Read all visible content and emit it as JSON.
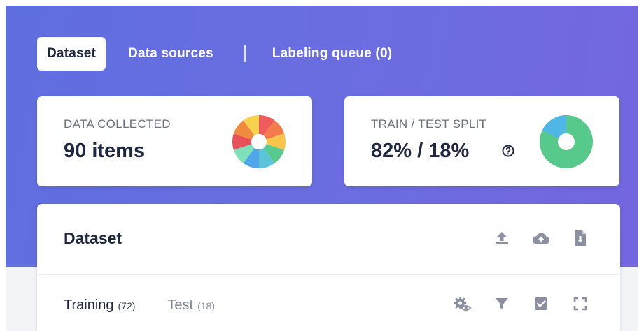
{
  "tabs": [
    {
      "label": "Dataset",
      "active": true
    },
    {
      "label": "Data sources",
      "active": false
    },
    {
      "label": "Labeling queue (0)",
      "active": false
    }
  ],
  "stats": {
    "collected": {
      "label": "DATA COLLECTED",
      "value": "90 items",
      "icon": "multicolor-donut-icon"
    },
    "split": {
      "label": "TRAIN / TEST SPLIT",
      "value": "82% / 18%",
      "help_icon": "question-circle-icon",
      "train_fraction": 0.82,
      "test_fraction": 0.18
    }
  },
  "dataset": {
    "title": "Dataset",
    "actions": [
      "upload-icon",
      "cloud-upload-icon",
      "download-file-icon"
    ],
    "subtabs": [
      {
        "label": "Training",
        "count": "(72)",
        "active": true
      },
      {
        "label": "Test",
        "count": "(18)",
        "active": false
      }
    ],
    "tools": [
      "settings-eye-icon",
      "filter-icon",
      "checkbox-icon",
      "expand-icon"
    ]
  },
  "colors": {
    "accent": "#6a6ee0",
    "train": "#57c98b",
    "test": "#4fb6e6",
    "icon": "#8a90a0"
  }
}
